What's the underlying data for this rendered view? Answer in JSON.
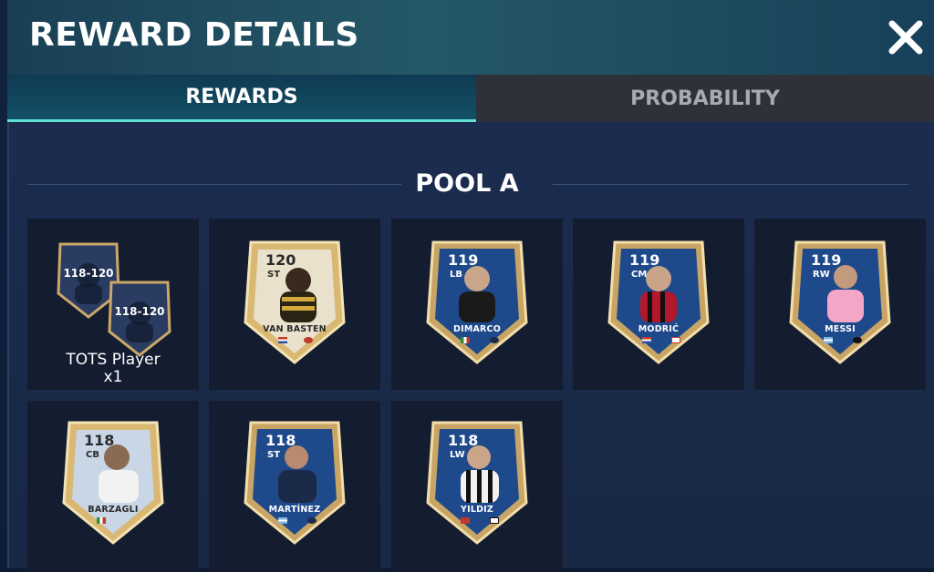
{
  "header": {
    "title": "REWARD DETAILS"
  },
  "tabs": [
    {
      "label": "REWARDS",
      "active": true
    },
    {
      "label": "PROBABILITY",
      "active": false
    }
  ],
  "pool": {
    "title": "POOL A"
  },
  "pack_reward": {
    "rating_range": "118-120",
    "label_line1": "TOTS Player",
    "label_line2": "x1"
  },
  "players": [
    {
      "name": "VAN BASTEN",
      "rating": "120",
      "position": "ST",
      "style": "gold"
    },
    {
      "name": "DIMARCO",
      "rating": "119",
      "position": "LB",
      "style": "blue"
    },
    {
      "name": "MODRIĆ",
      "rating": "119",
      "position": "CM",
      "style": "blue"
    },
    {
      "name": "MESSI",
      "rating": "119",
      "position": "RW",
      "style": "blue"
    },
    {
      "name": "BARZAGLI",
      "rating": "118",
      "position": "CB",
      "style": "gold"
    },
    {
      "name": "MARTÍNEZ",
      "rating": "118",
      "position": "ST",
      "style": "blue"
    },
    {
      "name": "YILDIZ",
      "rating": "118",
      "position": "LW",
      "style": "blue"
    }
  ],
  "colors": {
    "header_bg": "#245867",
    "tab_active": "#135065",
    "tab_inactive": "#2e3238",
    "accent": "#5ee0d3",
    "panel_bg": "#1b2c4f",
    "slot_bg": "#141c30",
    "card_gold": "#d9b874",
    "card_blue": "#1e4a8c"
  },
  "icons": {
    "close": "close-icon"
  }
}
